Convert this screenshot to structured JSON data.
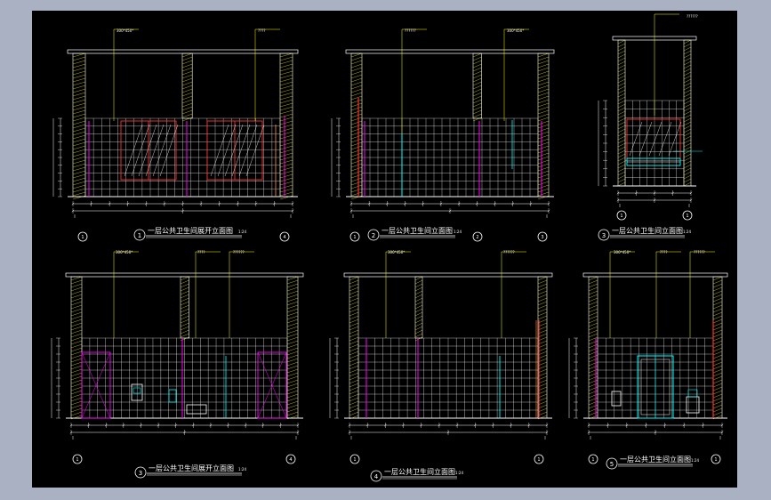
{
  "colors": {
    "window_bg": "#aab1c2",
    "canvas_bg": "#000000",
    "line_white": "#ffffff",
    "line_yellow": "#ffff00",
    "line_magenta": "#ff00ff",
    "line_cyan": "#00ffff",
    "line_red": "#ff3030",
    "line_orange": "#ff9a3a",
    "line_green": "#00ff00",
    "tile": "#ffffff"
  },
  "elevations": [
    {
      "id": "1",
      "title": "一层公共卫生间展开立面图",
      "scale": "1:24",
      "left_axis": "1",
      "right_axis": "4",
      "leaders": [
        "300*450*",
        "????"
      ]
    },
    {
      "id": "2",
      "title": "一层公共卫生间立面图",
      "scale": "1:24",
      "left_axis": "1",
      "mid_axis": "2",
      "right_axis": "3",
      "leaders": [
        "??????",
        "300*450*"
      ]
    },
    {
      "id": "3",
      "title": "一层公共卫生间立面图",
      "scale": "1:24",
      "left_axis": "1",
      "right_axis": "1",
      "leaders": [
        "??????"
      ]
    },
    {
      "id": "3",
      "title": "一层公共卫生间展开立面图",
      "scale": "1:24",
      "left_axis": "1",
      "right_axis": "4",
      "leaders": [
        "300*450*",
        "????",
        "??????"
      ]
    },
    {
      "id": "4",
      "title": "一层公共卫生间立面图",
      "scale": "1:24",
      "left_axis": "1",
      "right_axis": "1",
      "leaders": [
        "300*450*",
        "??????"
      ]
    },
    {
      "id": "5",
      "title": "一层公共卫生间立面图",
      "scale": "1:24",
      "left_axis": "1",
      "right_axis": "1",
      "leaders": [
        "300*450*",
        "????",
        "??????"
      ]
    }
  ]
}
